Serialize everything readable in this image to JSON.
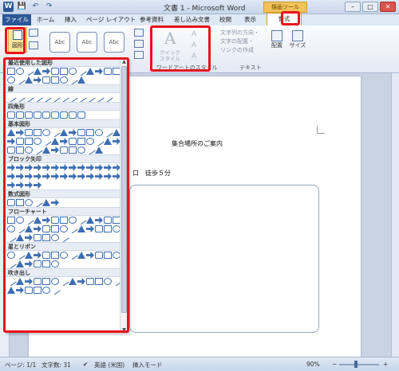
{
  "window": {
    "title": "文書 1 - Microsoft Word"
  },
  "quick_access": {
    "word_icon": "W",
    "save_icon": "💾",
    "undo_icon": "↶",
    "redo_icon": "↷"
  },
  "window_controls": {
    "minimize": "–",
    "maximize": "□",
    "close": "✕"
  },
  "context_group": "描画ツール",
  "tabs": [
    "ファイル",
    "ホーム",
    "挿入",
    "ページ レイアウト",
    "参考資料",
    "差し込み文書",
    "校閲",
    "表示",
    "書式"
  ],
  "ribbon": {
    "shape_button_label": "図形",
    "shape_styles": [
      "Abc",
      "Abc",
      "Abc"
    ],
    "quick_style_label": "クイック スタイル",
    "wordart_group_label": "ワードアートのスタイル",
    "text_group_label": "テキスト",
    "text_items": [
      "文字列の方向・",
      "文字の配置・",
      "リンクの作成"
    ],
    "arrange_label": "配置",
    "size_label": "サイズ"
  },
  "shape_gallery": {
    "categories": [
      {
        "name": "最近使用した図形",
        "rows": [
          14,
          9
        ]
      },
      {
        "name": "線",
        "rows": [
          12
        ]
      },
      {
        "name": "四角形",
        "rows": [
          9
        ]
      },
      {
        "name": "基本図形",
        "rows": [
          14,
          14,
          11
        ]
      },
      {
        "name": "ブロック矢印",
        "rows": [
          14,
          14,
          4
        ]
      },
      {
        "name": "数式図形",
        "rows": [
          6
        ]
      },
      {
        "name": "フローチャート",
        "rows": [
          14,
          14,
          7
        ]
      },
      {
        "name": "星とリボン",
        "rows": [
          14,
          6
        ]
      },
      {
        "name": "吹き出し",
        "rows": [
          14,
          6
        ]
      }
    ]
  },
  "document": {
    "title": "集合場所のご案内",
    "line": "口　徒歩５分"
  },
  "statusbar": {
    "page": "ページ: 1/1",
    "words": "文字数: 31",
    "language": "英語 (米国)",
    "mode": "挿入モード",
    "zoom": "90%",
    "zoom_out": "−",
    "zoom_in": "+"
  },
  "colors": {
    "highlight": "#e8141b",
    "accent": "#2b5797"
  }
}
